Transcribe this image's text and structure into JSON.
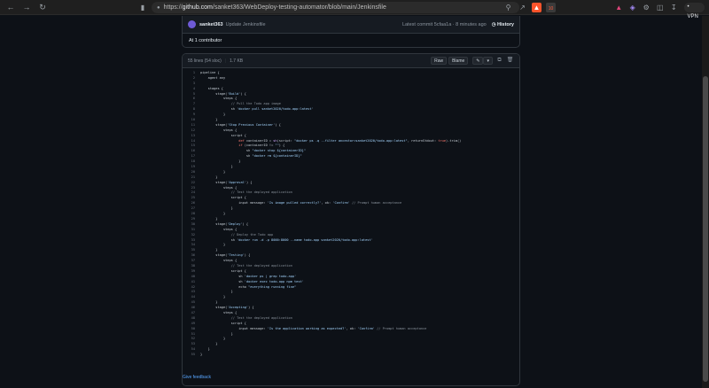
{
  "browser": {
    "url_prefix": "https://",
    "url_host": "github.com",
    "url_path": "/sanket363/WebDeploy-testing-automator/blob/main/Jenkinsfile",
    "vpn_label": "• VPN",
    "shields_count": "10"
  },
  "commit": {
    "author": "sanket363",
    "message": "Update Jenkinsfile",
    "latest_commit": "Latest commit 5cfaa1a · 8 minutes ago",
    "history_label": "History",
    "contributors": "At 1 contributor"
  },
  "file": {
    "lines_info": "55 lines (54 sloc)",
    "size": "1.7 KB",
    "raw_label": "Raw",
    "blame_label": "Blame",
    "lines": [
      [
        {
          "t": "pipeline {"
        }
      ],
      [
        {
          "t": "    agent any"
        }
      ],
      [
        {
          "t": ""
        }
      ],
      [
        {
          "t": "    stages {"
        }
      ],
      [
        {
          "t": "        stage("
        },
        {
          "t": "'Build'",
          "c": "s"
        },
        {
          "t": ") {"
        }
      ],
      [
        {
          "t": "            steps {"
        }
      ],
      [
        {
          "t": "                // Pull the Todo app image",
          "c": "c"
        }
      ],
      [
        {
          "t": "                sh "
        },
        {
          "t": "'docker pull sanket2020/todo-app:latest'",
          "c": "s"
        }
      ],
      [
        {
          "t": "            }"
        }
      ],
      [
        {
          "t": "        }"
        }
      ],
      [
        {
          "t": "        stage("
        },
        {
          "t": "'Stop Previous Container'",
          "c": "s"
        },
        {
          "t": ") {"
        }
      ],
      [
        {
          "t": "            steps {"
        }
      ],
      [
        {
          "t": "                script {"
        }
      ],
      [
        {
          "t": "                    "
        },
        {
          "t": "def",
          "c": "k"
        },
        {
          "t": " containerID = "
        },
        {
          "t": "sh",
          "c": "f"
        },
        {
          "t": "(script: "
        },
        {
          "t": "\"docker ps -q --filter ancestor=sanket2020/todo-app:latest\"",
          "c": "s"
        },
        {
          "t": ", returnStdout: "
        },
        {
          "t": "true",
          "c": "k"
        },
        {
          "t": ").trim()"
        }
      ],
      [
        {
          "t": "                    "
        },
        {
          "t": "if",
          "c": "k"
        },
        {
          "t": " (containerID != "
        },
        {
          "t": "\"\"",
          "c": "s"
        },
        {
          "t": ") {"
        }
      ],
      [
        {
          "t": "                        sh "
        },
        {
          "t": "\"docker stop ${containerID}\"",
          "c": "s"
        }
      ],
      [
        {
          "t": "                        sh "
        },
        {
          "t": "\"docker rm ${containerID}\"",
          "c": "s"
        }
      ],
      [
        {
          "t": "                    }"
        }
      ],
      [
        {
          "t": "                }"
        }
      ],
      [
        {
          "t": "            }"
        }
      ],
      [
        {
          "t": "        }"
        }
      ],
      [
        {
          "t": "        stage("
        },
        {
          "t": "'Approval'",
          "c": "s"
        },
        {
          "t": ") {"
        }
      ],
      [
        {
          "t": "            steps {"
        }
      ],
      [
        {
          "t": "                // Test the deployed application",
          "c": "c"
        }
      ],
      [
        {
          "t": "                script {"
        }
      ],
      [
        {
          "t": "                    input message: "
        },
        {
          "t": "'Is image pulled correctly?'",
          "c": "s"
        },
        {
          "t": ", ok: "
        },
        {
          "t": "'Confirm'",
          "c": "s"
        },
        {
          "t": " "
        },
        {
          "t": "// Prompt human acceptance",
          "c": "c"
        }
      ],
      [
        {
          "t": "                }"
        }
      ],
      [
        {
          "t": "            }"
        }
      ],
      [
        {
          "t": "        }"
        }
      ],
      [
        {
          "t": "        stage("
        },
        {
          "t": "'Deploy'",
          "c": "s"
        },
        {
          "t": ") {"
        }
      ],
      [
        {
          "t": "            steps {"
        }
      ],
      [
        {
          "t": "                // Deploy the Todo app",
          "c": "c"
        }
      ],
      [
        {
          "t": "                sh "
        },
        {
          "t": "'docker run -d -p 8000:8000 --name todo-app sanket2020/todo-app:latest'",
          "c": "s"
        }
      ],
      [
        {
          "t": "            }"
        }
      ],
      [
        {
          "t": "        }"
        }
      ],
      [
        {
          "t": "        stage("
        },
        {
          "t": "'Testing'",
          "c": "s"
        },
        {
          "t": ") {"
        }
      ],
      [
        {
          "t": "            steps {"
        }
      ],
      [
        {
          "t": "                // Test the deployed application",
          "c": "c"
        }
      ],
      [
        {
          "t": "                script {"
        }
      ],
      [
        {
          "t": "                    sh "
        },
        {
          "t": "'docker ps | grep todo-app'",
          "c": "s"
        }
      ],
      [
        {
          "t": "                    sh "
        },
        {
          "t": "'docker exec todo-app npm test'",
          "c": "s"
        }
      ],
      [
        {
          "t": "                    echo "
        },
        {
          "t": "\"everything running fine\"",
          "c": "s"
        }
      ],
      [
        {
          "t": "                }"
        }
      ],
      [
        {
          "t": "            }"
        }
      ],
      [
        {
          "t": "        }"
        }
      ],
      [
        {
          "t": "        stage("
        },
        {
          "t": "'Accepting'",
          "c": "s"
        },
        {
          "t": ") {"
        }
      ],
      [
        {
          "t": "            steps {"
        }
      ],
      [
        {
          "t": "                // Test the deployed application",
          "c": "c"
        }
      ],
      [
        {
          "t": "                script {"
        }
      ],
      [
        {
          "t": "                    input message: "
        },
        {
          "t": "'Is the application working as expected?'",
          "c": "s"
        },
        {
          "t": ", ok: "
        },
        {
          "t": "'Confirm'",
          "c": "s"
        },
        {
          "t": " "
        },
        {
          "t": "// Prompt human acceptance",
          "c": "c"
        }
      ],
      [
        {
          "t": "                }"
        }
      ],
      [
        {
          "t": "            }"
        }
      ],
      [
        {
          "t": "        }"
        }
      ],
      [
        {
          "t": "    }"
        }
      ],
      [
        {
          "t": "}"
        }
      ]
    ]
  },
  "footer": {
    "feedback_label": "Give feedback"
  }
}
